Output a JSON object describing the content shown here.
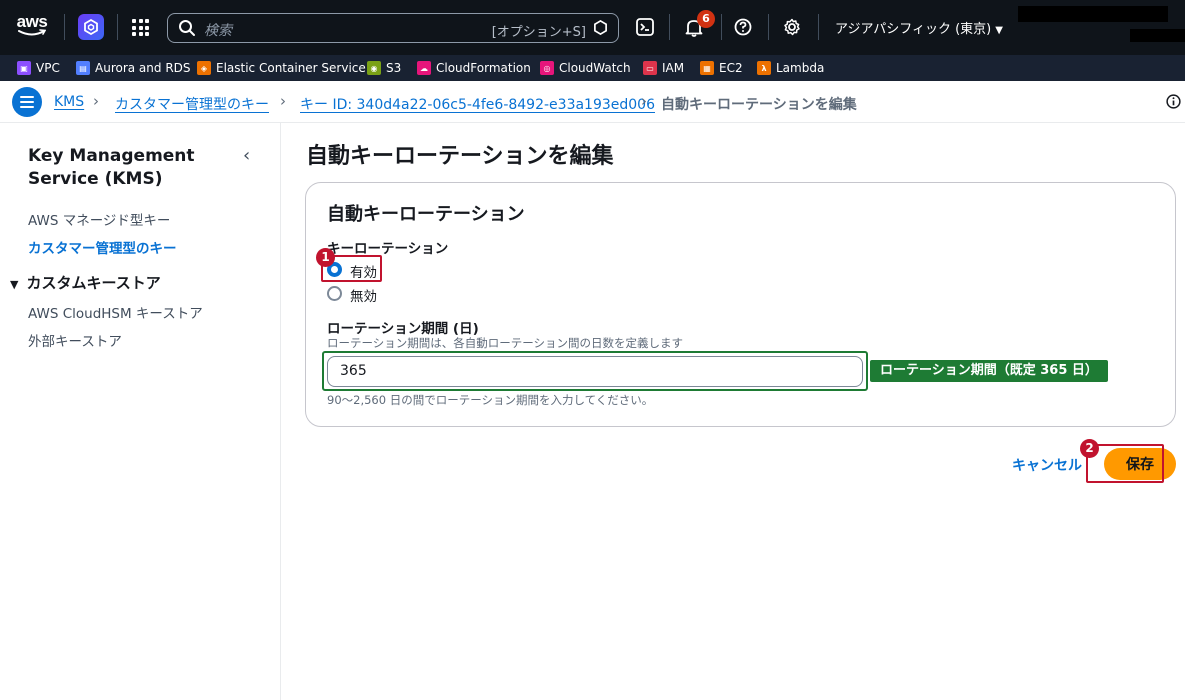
{
  "topnav": {
    "logo": "aws",
    "search_placeholder": "検索",
    "search_shortcut": "[オプション+S]",
    "notification_count": "6",
    "region": "アジアパシフィック (東京)"
  },
  "favorites": [
    {
      "label": "VPC",
      "color": "#8c4fff"
    },
    {
      "label": "Aurora and RDS",
      "color": "#527fff"
    },
    {
      "label": "Elastic Container Service",
      "color": "#ed7100"
    },
    {
      "label": "S3",
      "color": "#7aa116"
    },
    {
      "label": "CloudFormation",
      "color": "#e7157b"
    },
    {
      "label": "CloudWatch",
      "color": "#e7157b"
    },
    {
      "label": "IAM",
      "color": "#dd344c"
    },
    {
      "label": "EC2",
      "color": "#ed7100"
    },
    {
      "label": "Lambda",
      "color": "#ed7100"
    }
  ],
  "breadcrumb": {
    "items": [
      "KMS",
      "カスタマー管理型のキー",
      "キー ID: 340d4a22-06c5-4fe6-8492-e33a193ed006"
    ],
    "current": "自動キーローテーションを編集"
  },
  "sidebar": {
    "title": "Key Management Service (KMS)",
    "items": [
      "AWS マネージド型キー",
      "カスタマー管理型のキー"
    ],
    "group": "カスタムキーストア",
    "group_items": [
      "AWS CloudHSM キーストア",
      "外部キーストア"
    ]
  },
  "main": {
    "title": "自動キーローテーションを編集",
    "card_title": "自動キーローテーション",
    "rotation_label": "キーローテーション",
    "options": [
      "有効",
      "無効"
    ],
    "selected_option": "有効",
    "period_label": "ローテーション期間 (日)",
    "period_description": "ローテーション期間は、各自動ローテーション間の日数を定義します",
    "period_value": "365",
    "period_hint": "90〜2,560 日の間でローテーション期間を入力してください。",
    "period_annotation": "ローテーション期間（既定 365 日）",
    "cancel": "キャンセル",
    "save": "保存"
  },
  "annotations": [
    "1",
    "2"
  ],
  "colors": {
    "accent": "#0972d3",
    "primary_button": "#ff9900",
    "annotation_red": "#c1132e",
    "annotation_green": "#1e7b34"
  }
}
